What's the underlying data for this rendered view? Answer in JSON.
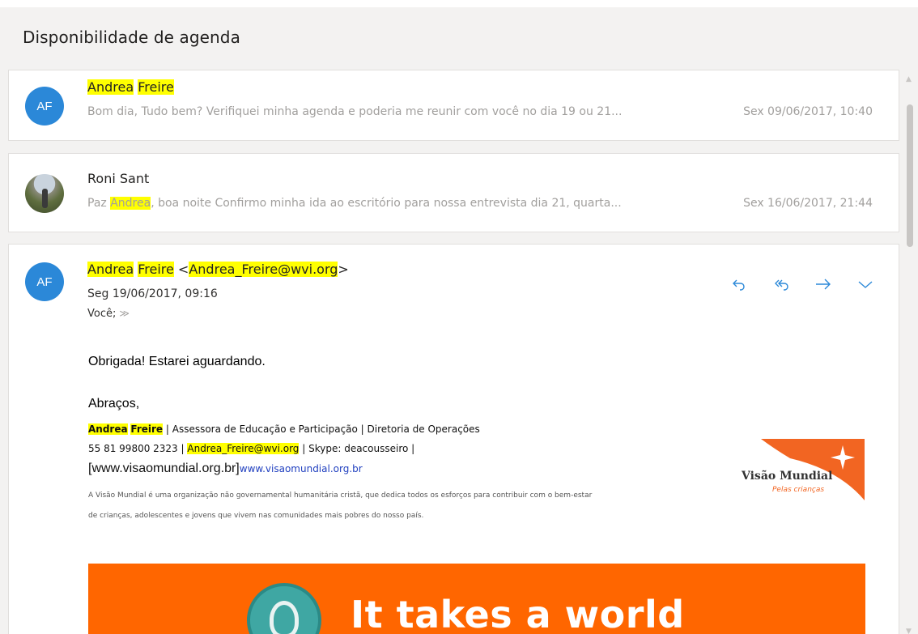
{
  "conversation": {
    "subject": "Disponibilidade de agenda"
  },
  "messages": [
    {
      "avatar_initials": "AF",
      "sender_first": "Andrea",
      "sender_last": "Freire",
      "preview_text": "Bom dia, Tudo bem? Verifiquei minha agenda e poderia me reunir com você no dia 19 ou 21...",
      "date": "Sex 09/06/2017, 10:40"
    },
    {
      "sender": "Roni Sant",
      "preview_prefix": "Paz ",
      "preview_highlight": "Andrea",
      "preview_rest": ", boa noite Confirmo minha ida ao escritório para nossa entrevista dia 21, quarta...",
      "date": "Sex 16/06/2017, 21:44"
    }
  ],
  "open_message": {
    "avatar_initials": "AF",
    "sender_first": "Andrea",
    "sender_last": "Freire",
    "lt": " <",
    "sender_email": "Andrea_Freire@wvi.org",
    "gt": ">",
    "date": "Seg 19/06/2017, 09:16",
    "to": "Você;",
    "expand_glyph": "≫",
    "actions": {
      "reply_icon": "reply-icon",
      "reply_all_icon": "reply-all-icon",
      "forward_icon": "forward-icon",
      "more_icon": "chevron-down-icon"
    },
    "body": {
      "line1": "Obrigada! Estarei aguardando.",
      "line2": "Abraços,",
      "sig_name_first": "Andrea",
      "sig_name_last": "Freire",
      "sig_role": " | Assessora de Educação e Participação | Diretoria de Operações",
      "sig_phone": "55 81 99800 2323 | ",
      "sig_email": "Andrea_Freire@wvi.org",
      "sig_skype": " | Skype: deacousseiro |",
      "sig_site_bracket": "[www.visaomundial.org.br]",
      "sig_site_link": "www.visaomundial.org.br",
      "disclaimer_1": "A Visão Mundial é uma organização não governamental humanitária cristã, que dedica todos os esforços para contribuir com o bem-estar",
      "disclaimer_2": "de crianças, adolescentes e jovens que vivem nas comunidades mais pobres do nosso país.",
      "logo_name": "Visão Mundial",
      "logo_tagline": "Pelas crianças",
      "banner_text": "It takes a world"
    }
  },
  "colors": {
    "avatar_blue": "#2b88d8",
    "highlight": "#ffff00",
    "action_blue": "#2b88d8",
    "banner_orange": "#ff6600"
  }
}
